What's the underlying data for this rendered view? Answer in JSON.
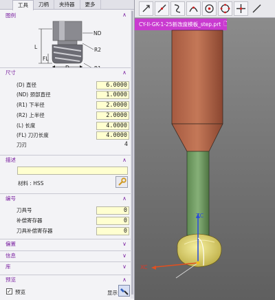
{
  "tabs": [
    "工具",
    "刀柄",
    "夹持器",
    "更多"
  ],
  "sections": {
    "illustration": "图例",
    "dimensions": "尺寸",
    "description": "描述",
    "numbering": "编号",
    "offsets": "偏置",
    "info": "信息",
    "library": "库",
    "preview": "预览"
  },
  "diagram_labels": {
    "d": "D",
    "nd": "ND",
    "r2": "R2",
    "l": "L",
    "fl": "FL",
    "r1": "R1"
  },
  "dimension_fields": [
    {
      "label": "(D) 直径",
      "value": "6.0000"
    },
    {
      "label": "(ND) 颈部直径",
      "value": "1.0000"
    },
    {
      "label": "(R1) 下半径",
      "value": "2.0000"
    },
    {
      "label": "(R2) 上半径",
      "value": "2.0000"
    },
    {
      "label": "(L) 长度",
      "value": "4.0000"
    },
    {
      "label": "(FL) 刀刃长度",
      "value": "4.0000"
    },
    {
      "label": "刀刃",
      "value": "4"
    }
  ],
  "description": {
    "text": "",
    "material": "材料 : HSS"
  },
  "numbering_fields": [
    {
      "label": "刀具号",
      "value": "0"
    },
    {
      "label": "补偿寄存器",
      "value": "0"
    },
    {
      "label": "刀具补偿寄存器",
      "value": "0"
    }
  ],
  "preview": {
    "checkbox_label": "预览",
    "checked": true,
    "show_label": "显示"
  },
  "viewport": {
    "file_tab": "CY-II-GK-1-25新改度模板_step.prt",
    "axis_x": "XC",
    "axis_z": "ZC",
    "toolbar_icons": [
      "snap-arrow-icon",
      "line-icon",
      "curve-icon",
      "arc-icon",
      "circle-center-icon",
      "quadrant-icon",
      "intersection-icon",
      "slash-icon"
    ]
  }
}
